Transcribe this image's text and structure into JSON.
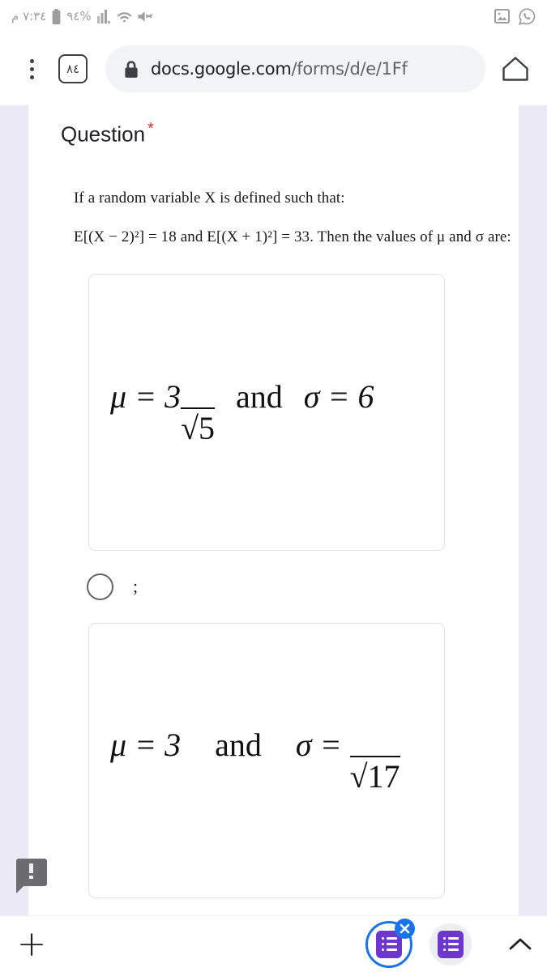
{
  "status_bar": {
    "time": "٧:٣٤ م",
    "battery_percent": "٩٤%",
    "icons": [
      "battery-icon",
      "signal-icon",
      "wifi-icon",
      "mute-icon"
    ],
    "notification_icons": [
      "image-icon",
      "whatsapp-icon"
    ],
    "text_color": "#9e9e9e"
  },
  "browser": {
    "menu_icon": "three-dots-icon",
    "tab_count": "٨٤",
    "url_host": "docs.google.com",
    "url_path": "/forms/d/e/1Ff",
    "lock_icon": "lock-icon",
    "home_icon": "home-icon"
  },
  "form": {
    "question_title": "Question",
    "required_mark": "*",
    "page_bg": "#ebe9f5",
    "required_color": "#d93025",
    "prompt_line1": "If a random variable X is defined such that:",
    "prompt_line2": "E[(X − 2)²] = 18  and  E[(X + 1)²] = 33. Then the values of μ and σ are:",
    "options": [
      {
        "type": "image",
        "alt": "μ = 3√5 and σ = 6",
        "mu_label": "μ = 3",
        "radicand": "5",
        "and_label": "and",
        "sigma_label": "σ = 6",
        "sigma_radicand": ""
      },
      {
        "type": "image",
        "alt": "μ = 3 and σ = √17",
        "mu_label": "μ = 3",
        "radicand": "",
        "and_label": "and",
        "sigma_label": "σ = ",
        "sigma_radicand": "17"
      }
    ],
    "radio_label": ";",
    "radio_selected": false,
    "feedback_icon": "feedback-report-icon"
  },
  "bottom_bar": {
    "add_icon": "plus-icon",
    "tabs": [
      {
        "icon": "google-forms-icon",
        "active": true,
        "close_icon": "close-icon"
      },
      {
        "icon": "google-forms-icon",
        "active": false
      }
    ],
    "expand_icon": "chevron-up-icon",
    "accent_color": "#1a73e8",
    "forms_color": "#6f35cf"
  }
}
